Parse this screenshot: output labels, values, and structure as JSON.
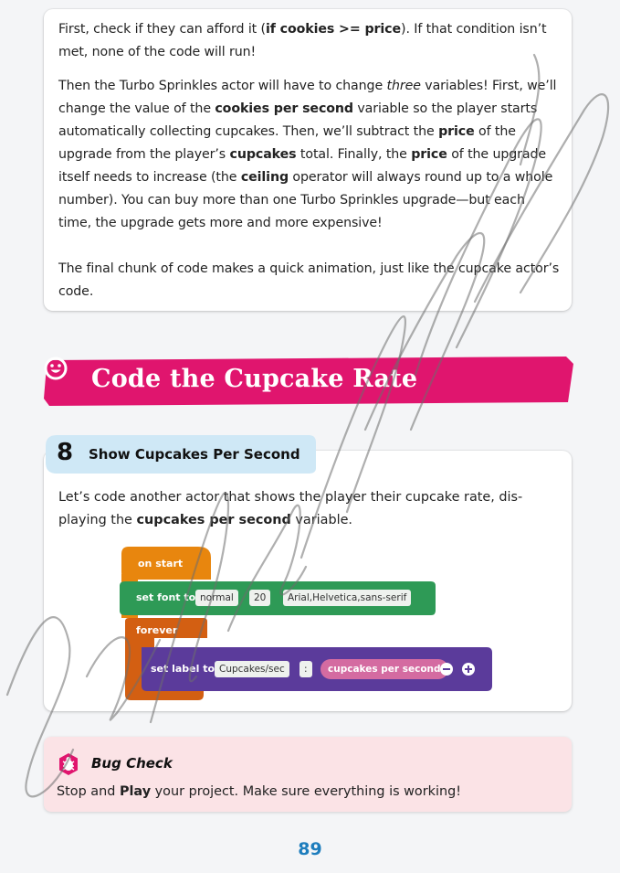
{
  "intro": {
    "p1": [
      {
        "t": "First, check if they can afford it ("
      },
      {
        "t": "if cookies >= price",
        "b": true
      },
      {
        "t": "). If that condition isn’t met, none of the code will run!"
      }
    ],
    "p2": [
      {
        "t": "Then the Turbo Sprinkles actor will have to change "
      },
      {
        "t": "three",
        "i": true
      },
      {
        "t": " variables! First, we’ll change the value of the "
      },
      {
        "t": "cookies per second",
        "b": true
      },
      {
        "t": " variable so the player starts automatically collecting cupcakes. Then, we’ll subtract the "
      },
      {
        "t": "price",
        "b": true
      },
      {
        "t": " of the upgrade from the player’s "
      },
      {
        "t": "cupcakes",
        "b": true
      },
      {
        "t": " total. Finally, the "
      },
      {
        "t": "price",
        "b": true
      },
      {
        "t": " of the upgrade itself needs to increase (the "
      },
      {
        "t": "ceiling",
        "b": true
      },
      {
        "t": " operator will always round up to a whole number). You can buy more than one Turbo Sprinkles upgrade—but each time, the upgrade gets more and more expensive!"
      }
    ],
    "p3": [
      {
        "t": "The final chunk of code makes a quick animation, just like the cupcake actor’s code."
      }
    ]
  },
  "section": {
    "title": "Code the Cupcake Rate",
    "color": "#e0156e"
  },
  "step": {
    "number": "8",
    "title": "Show Cupcakes Per Second",
    "text": [
      {
        "t": "Let’s code another actor that shows the player their cupcake rate, dis-playing the "
      },
      {
        "t": "cupcakes per second",
        "b": true
      },
      {
        "t": " variable."
      }
    ]
  },
  "code": {
    "on_start": "on start",
    "set_font_to": "set font to",
    "font_style": "normal",
    "font_size": "20",
    "font_family": "Arial,Helvetica,sans-serif",
    "forever": "forever",
    "set_label_to": "set label to",
    "label_text": "Cupcakes/sec",
    "separator": ":",
    "variable": "cupcakes per second",
    "colors": {
      "events": "#e8860e",
      "looks": "#2e9a56",
      "control": "#d35f12",
      "label": "#5b3b9b",
      "var": "#d46ba1"
    }
  },
  "bug_check": {
    "title": "Bug Check",
    "text": [
      {
        "t": "Stop and "
      },
      {
        "t": "Play",
        "b": true
      },
      {
        "t": " your project. Make sure everything is working!"
      }
    ]
  },
  "page_number": "89"
}
